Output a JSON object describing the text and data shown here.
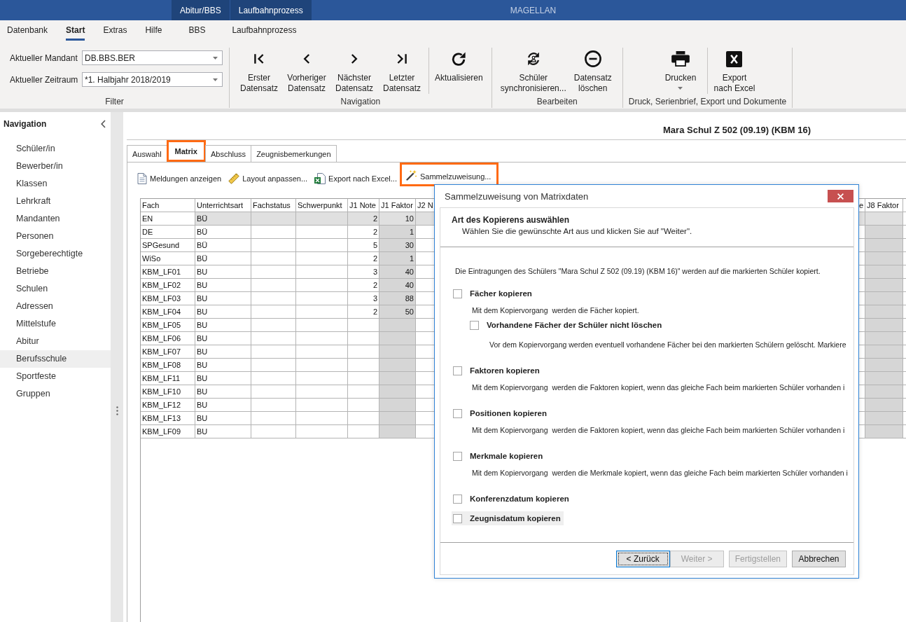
{
  "title_bar": {
    "context_tabs": [
      "Abitur/BBS",
      "Laufbahnprozess"
    ],
    "app_name": "MAGELLAN"
  },
  "ribbon_tabs": [
    {
      "label": "Datenbank",
      "selected": false
    },
    {
      "label": "Start",
      "selected": true
    },
    {
      "label": "Extras",
      "selected": false
    },
    {
      "label": "Hilfe",
      "selected": false
    },
    {
      "label": "BBS",
      "selected": false
    },
    {
      "label": "Laufbahnprozess",
      "selected": false
    }
  ],
  "ribbon_groups": [
    {
      "kind": "filter",
      "label": "Filter",
      "fields": [
        {
          "label": "Aktueller Mandant",
          "value": "DB.BBS.BER"
        },
        {
          "label": "Aktueller Zeitraum",
          "value": "*1. Halbjahr 2018/2019"
        }
      ]
    },
    {
      "kind": "buttons",
      "label": "Navigation",
      "sections": [
        {
          "buttons": [
            {
              "kind": "first",
              "lines": [
                "Erster",
                "Datensatz"
              ]
            },
            {
              "kind": "previous",
              "lines": [
                "Vorheriger",
                "Datensatz"
              ]
            },
            {
              "kind": "next",
              "lines": [
                "Nächster",
                "Datensatz"
              ]
            },
            {
              "kind": "last",
              "lines": [
                "Letzter",
                "Datensatz"
              ]
            }
          ]
        },
        {
          "buttons": [
            {
              "kind": "refresh",
              "lines": [
                "Aktualisieren"
              ]
            }
          ]
        }
      ]
    },
    {
      "kind": "buttons",
      "label": "Bearbeiten",
      "sections": [
        {
          "buttons": [
            {
              "kind": "sync",
              "lines": [
                "Schüler",
                "synchronisieren..."
              ]
            },
            {
              "kind": "delete",
              "lines": [
                "Datensatz",
                "löschen"
              ]
            }
          ]
        }
      ]
    },
    {
      "kind": "buttons",
      "label": "Druck, Serienbrief, Export und Dokumente",
      "sections": [
        {
          "buttons": [
            {
              "kind": "print",
              "lines": [
                "Drucken"
              ],
              "dropdown": true
            }
          ]
        },
        {
          "buttons": [
            {
              "kind": "excel",
              "lines": [
                "Export",
                "nach Excel"
              ]
            }
          ]
        }
      ]
    }
  ],
  "sidebar": {
    "title": "Navigation",
    "items": [
      {
        "label": "Schüler/in",
        "selected": false
      },
      {
        "label": "Bewerber/in",
        "selected": false
      },
      {
        "label": "Klassen",
        "selected": false
      },
      {
        "label": "Lehrkraft",
        "selected": false
      },
      {
        "label": "Mandanten",
        "selected": false
      },
      {
        "label": "Personen",
        "selected": false
      },
      {
        "label": "Sorgeberechtigte",
        "selected": false
      },
      {
        "label": "Betriebe",
        "selected": false
      },
      {
        "label": "Schulen",
        "selected": false
      },
      {
        "label": "Adressen",
        "selected": false
      },
      {
        "label": "Mittelstufe",
        "selected": false
      },
      {
        "label": "Abitur",
        "selected": false
      },
      {
        "label": "Berufsschule",
        "selected": true
      },
      {
        "label": "Sportfeste",
        "selected": false
      },
      {
        "label": "Gruppen",
        "selected": false
      }
    ]
  },
  "record_title": "Mara Schul Z 502 (09.19) (KBM 16)",
  "tabs": [
    {
      "label": "Auswahl",
      "selected": false,
      "highlighted": false
    },
    {
      "label": "Matrix",
      "selected": true,
      "highlighted": true
    },
    {
      "label": "Abschluss",
      "selected": false,
      "highlighted": false
    },
    {
      "label": "Zeugnisbemerkungen",
      "selected": false,
      "highlighted": false
    }
  ],
  "toolbar": [
    {
      "kind": "messages",
      "label": "Meldungen anzeigen",
      "highlighted": false
    },
    {
      "kind": "layout",
      "label": "Layout anpassen...",
      "highlighted": false
    },
    {
      "kind": "export",
      "label": "Export nach Excel...",
      "highlighted": false
    },
    {
      "kind": "assign",
      "label": "Sammelzuweisung...",
      "highlighted": true
    }
  ],
  "table": {
    "left_columns": [
      {
        "label": "Fach",
        "kind": "text"
      },
      {
        "label": "Unterrichtsart",
        "kind": "text"
      },
      {
        "label": "Fachstatus",
        "kind": "text"
      },
      {
        "label": "Schwerpunkt",
        "kind": "text"
      },
      {
        "label": "J1 Note",
        "kind": "number"
      },
      {
        "label": "J1 Faktor",
        "kind": "factor"
      },
      {
        "label": "J2 N",
        "kind": "number"
      }
    ],
    "right_columns": [
      {
        "label": "e",
        "kind": "number"
      },
      {
        "label": "J8 Faktor",
        "kind": "factor"
      }
    ],
    "rows": [
      {
        "selected": true,
        "cells": [
          "EN",
          "BÜ",
          null,
          null,
          "2",
          "10",
          null
        ]
      },
      {
        "selected": false,
        "cells": [
          "DE",
          "BÜ",
          null,
          null,
          "2",
          "1",
          null
        ]
      },
      {
        "selected": false,
        "cells": [
          "SPGesund",
          "BÜ",
          null,
          null,
          "5",
          "30",
          null
        ]
      },
      {
        "selected": false,
        "cells": [
          "WiSo",
          "BÜ",
          null,
          null,
          "2",
          "1",
          null
        ]
      },
      {
        "selected": false,
        "cells": [
          "KBM_LF01",
          "BU",
          null,
          null,
          "3",
          "40",
          null
        ]
      },
      {
        "selected": false,
        "cells": [
          "KBM_LF02",
          "BU",
          null,
          null,
          "2",
          "40",
          null
        ]
      },
      {
        "selected": false,
        "cells": [
          "KBM_LF03",
          "BU",
          null,
          null,
          "3",
          "88",
          null
        ]
      },
      {
        "selected": false,
        "cells": [
          "KBM_LF04",
          "BU",
          null,
          null,
          "2",
          "50",
          null
        ]
      },
      {
        "selected": false,
        "cells": [
          "KBM_LF05",
          "BU",
          null,
          null,
          null,
          null,
          null
        ]
      },
      {
        "selected": false,
        "cells": [
          "KBM_LF06",
          "BU",
          null,
          null,
          null,
          null,
          null
        ]
      },
      {
        "selected": false,
        "cells": [
          "KBM_LF07",
          "BU",
          null,
          null,
          null,
          null,
          null
        ]
      },
      {
        "selected": false,
        "cells": [
          "KBM_LF08",
          "BU",
          null,
          null,
          null,
          null,
          null
        ]
      },
      {
        "selected": false,
        "cells": [
          "KBM_LF11",
          "BU",
          null,
          null,
          null,
          null,
          null
        ]
      },
      {
        "selected": false,
        "cells": [
          "KBM_LF10",
          "BU",
          null,
          null,
          null,
          null,
          null
        ]
      },
      {
        "selected": false,
        "cells": [
          "KBM_LF12",
          "BU",
          null,
          null,
          null,
          null,
          null
        ]
      },
      {
        "selected": false,
        "cells": [
          "KBM_LF13",
          "BU",
          null,
          null,
          null,
          null,
          null
        ]
      },
      {
        "selected": false,
        "cells": [
          "KBM_LF09",
          "BU",
          null,
          null,
          null,
          null,
          null
        ]
      }
    ]
  },
  "dialog": {
    "title": "Sammelzuweisung von Matrixdaten",
    "heading": "Art des Kopierens auswählen",
    "subheading": "Wählen Sie die gewünschte Art aus und klicken Sie auf \"Weiter\".",
    "intro": "Die Eintragungen des Schülers \"Mara Schul Z 502 (09.19) (KBM 16)\" werden auf die markierten Schüler kopiert.",
    "options": [
      {
        "label": "Fächer kopieren",
        "checked": false,
        "focused": false,
        "description": "Mit dem Kopiervorgang  werden die Fächer kopiert.",
        "children": [
          {
            "label": "Vorhandene Fächer der Schüler nicht löschen",
            "checked": false,
            "focused": false,
            "description": "Vor dem Kopiervorgang werden eventuell vorhandene Fächer bei den markierten Schülern gelöscht. Markiere"
          }
        ]
      },
      {
        "label": "Faktoren kopieren",
        "checked": false,
        "focused": false,
        "description": "Mit dem Kopiervorgang  werden die Faktoren kopiert, wenn das gleiche Fach beim markierten Schüler vorhanden i"
      },
      {
        "label": "Positionen kopieren",
        "checked": false,
        "focused": false,
        "description": "Mit dem Kopiervorgang  werden die Faktoren kopiert, wenn das gleiche Fach beim markierten Schüler vorhanden i"
      },
      {
        "label": "Merkmale kopieren",
        "checked": false,
        "focused": false,
        "description": "Mit dem Kopiervorgang  werden die Merkmale kopiert, wenn das gleiche Fach beim markierten Schüler vorhanden i"
      },
      {
        "label": "Konferenzdatum kopieren",
        "checked": false,
        "focused": false
      },
      {
        "label": "Zeugnisdatum kopieren",
        "checked": false,
        "focused": true
      }
    ],
    "buttons": [
      {
        "label": "< Zurück",
        "disabled": false,
        "focused": true
      },
      {
        "label": "Weiter >",
        "disabled": true,
        "focused": false
      },
      {
        "label": "Fertigstellen",
        "disabled": true,
        "focused": false
      },
      {
        "label": "Abbrechen",
        "disabled": false,
        "focused": false
      }
    ]
  }
}
